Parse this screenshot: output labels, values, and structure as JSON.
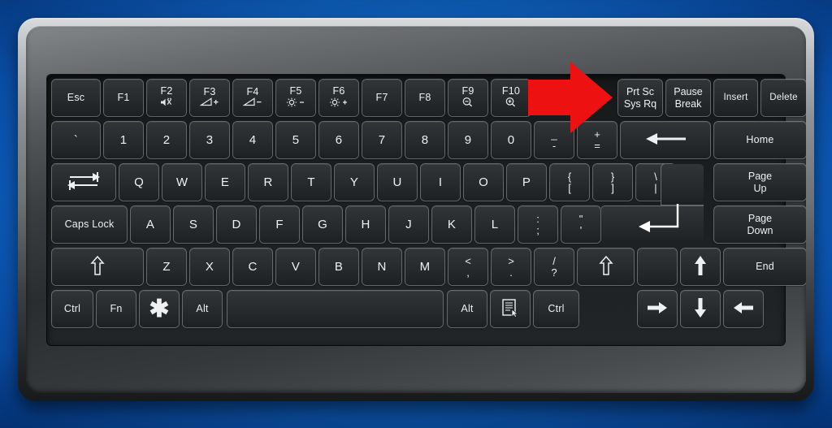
{
  "scene": {
    "subject": "computer-keyboard",
    "background_color": "#1f7ad6",
    "chassis_color": "#6e7174",
    "key_color": "#2a2d2f",
    "key_label_color": "#eef0f2",
    "annotation": {
      "type": "arrow",
      "color": "#ee1111",
      "direction": "right",
      "points_to": "Prt Sc / Sys Rq"
    }
  },
  "keyboard": {
    "rows": [
      {
        "name": "function-row",
        "keys": [
          {
            "name": "escape",
            "label": "Esc"
          },
          {
            "name": "f1",
            "label": "F1"
          },
          {
            "name": "f2",
            "label": "F2",
            "sub": "mute-icon"
          },
          {
            "name": "f3",
            "label": "F3",
            "sub": "volume-down-icon"
          },
          {
            "name": "f4",
            "label": "F4",
            "sub": "volume-up-icon"
          },
          {
            "name": "f5",
            "label": "F5",
            "sub": "brightness-down-icon"
          },
          {
            "name": "f6",
            "label": "F6",
            "sub": "brightness-up-icon"
          },
          {
            "name": "f7",
            "label": "F7"
          },
          {
            "name": "f8",
            "label": "F8"
          },
          {
            "name": "f9",
            "label": "F9",
            "sub": "zoom-out-icon"
          },
          {
            "name": "f10",
            "label": "F10",
            "sub": "zoom-in-icon"
          },
          {
            "name": "print-screen",
            "label": "Prt Sc",
            "label2": "Sys Rq"
          },
          {
            "name": "pause-break",
            "label": "Pause",
            "label2": "Break"
          },
          {
            "name": "insert",
            "label": "Insert"
          },
          {
            "name": "delete",
            "label": "Delete"
          }
        ]
      },
      {
        "name": "number-row",
        "keys": [
          {
            "name": "backtick",
            "label": "`"
          },
          {
            "name": "digit-1",
            "label": "1"
          },
          {
            "name": "digit-2",
            "label": "2"
          },
          {
            "name": "digit-3",
            "label": "3"
          },
          {
            "name": "digit-4",
            "label": "4"
          },
          {
            "name": "digit-5",
            "label": "5"
          },
          {
            "name": "digit-6",
            "label": "6"
          },
          {
            "name": "digit-7",
            "label": "7"
          },
          {
            "name": "digit-8",
            "label": "8"
          },
          {
            "name": "digit-9",
            "label": "9"
          },
          {
            "name": "digit-0",
            "label": "0"
          },
          {
            "name": "minus",
            "label": "_",
            "label2": "-"
          },
          {
            "name": "equals",
            "label": "+",
            "label2": "="
          },
          {
            "name": "backspace",
            "label": "backspace-arrow-icon"
          },
          {
            "name": "home",
            "label": "Home"
          }
        ]
      },
      {
        "name": "qwerty-row",
        "keys": [
          {
            "name": "tab",
            "label": "tab-icon"
          },
          {
            "name": "letter-q",
            "label": "Q"
          },
          {
            "name": "letter-w",
            "label": "W"
          },
          {
            "name": "letter-e",
            "label": "E"
          },
          {
            "name": "letter-r",
            "label": "R"
          },
          {
            "name": "letter-t",
            "label": "T"
          },
          {
            "name": "letter-y",
            "label": "Y"
          },
          {
            "name": "letter-u",
            "label": "U"
          },
          {
            "name": "letter-i",
            "label": "I"
          },
          {
            "name": "letter-o",
            "label": "O"
          },
          {
            "name": "letter-p",
            "label": "P"
          },
          {
            "name": "bracket-left",
            "label": "{",
            "label2": "["
          },
          {
            "name": "bracket-right",
            "label": "}",
            "label2": "]"
          },
          {
            "name": "backslash",
            "label": "\\",
            "label2": "|"
          },
          {
            "name": "enter",
            "label": "enter-arrow-icon"
          },
          {
            "name": "page-up",
            "label": "Page",
            "label2": "Up"
          }
        ]
      },
      {
        "name": "home-row",
        "keys": [
          {
            "name": "caps-lock",
            "label": "Caps Lock"
          },
          {
            "name": "letter-a",
            "label": "A"
          },
          {
            "name": "letter-s",
            "label": "S"
          },
          {
            "name": "letter-d",
            "label": "D"
          },
          {
            "name": "letter-f",
            "label": "F"
          },
          {
            "name": "letter-g",
            "label": "G"
          },
          {
            "name": "letter-h",
            "label": "H"
          },
          {
            "name": "letter-j",
            "label": "J"
          },
          {
            "name": "letter-k",
            "label": "K"
          },
          {
            "name": "letter-l",
            "label": "L"
          },
          {
            "name": "semicolon",
            "label": ":",
            "label2": ";"
          },
          {
            "name": "quote",
            "label": "\"",
            "label2": "'"
          },
          {
            "name": "page-down",
            "label": "Page",
            "label2": "Down"
          }
        ]
      },
      {
        "name": "shift-row",
        "keys": [
          {
            "name": "shift-left",
            "label": "shift-arrow-icon"
          },
          {
            "name": "letter-z",
            "label": "Z"
          },
          {
            "name": "letter-x",
            "label": "X"
          },
          {
            "name": "letter-c",
            "label": "C"
          },
          {
            "name": "letter-v",
            "label": "V"
          },
          {
            "name": "letter-b",
            "label": "B"
          },
          {
            "name": "letter-n",
            "label": "N"
          },
          {
            "name": "letter-m",
            "label": "M"
          },
          {
            "name": "comma",
            "label": "<",
            "label2": ","
          },
          {
            "name": "period",
            "label": ">",
            "label2": "."
          },
          {
            "name": "slash",
            "label": "/",
            "label2": "?"
          },
          {
            "name": "shift-right",
            "label": "shift-arrow-icon"
          },
          {
            "name": "blank-key",
            "label": ""
          },
          {
            "name": "arrow-up",
            "label": "arrow-up-icon"
          },
          {
            "name": "end",
            "label": "End"
          }
        ]
      },
      {
        "name": "bottom-row",
        "keys": [
          {
            "name": "ctrl-left",
            "label": "Ctrl"
          },
          {
            "name": "fn",
            "label": "Fn"
          },
          {
            "name": "super",
            "label": "asterisk-icon"
          },
          {
            "name": "alt-left",
            "label": "Alt"
          },
          {
            "name": "space",
            "label": ""
          },
          {
            "name": "alt-right",
            "label": "Alt"
          },
          {
            "name": "menu",
            "label": "menu-icon"
          },
          {
            "name": "ctrl-right",
            "label": "Ctrl"
          },
          {
            "name": "arrow-left",
            "label": "arrow-left-icon"
          },
          {
            "name": "arrow-down",
            "label": "arrow-down-icon"
          },
          {
            "name": "arrow-right",
            "label": "arrow-right-icon"
          }
        ]
      }
    ]
  }
}
